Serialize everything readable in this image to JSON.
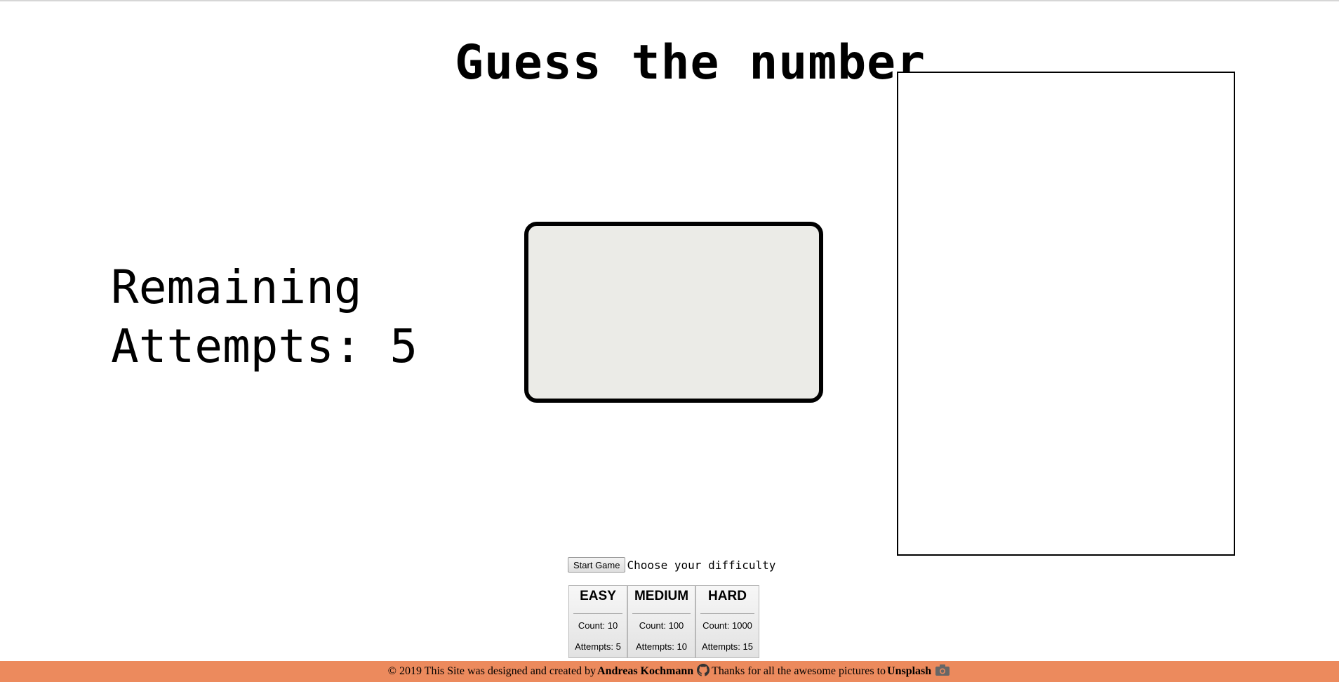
{
  "game": {
    "title": "Guess the number",
    "attempts_label": "Remaining",
    "attempts_line2": "Attempts: 5",
    "remaining_attempts": 5,
    "current_number": ""
  },
  "controls": {
    "start_label": "Start Game",
    "difficulty_prompt": "Choose your difficulty"
  },
  "difficulties": [
    {
      "name": "EASY",
      "count": "Count: 10",
      "attempts": "Attempts: 5"
    },
    {
      "name": "MEDIUM",
      "count": "Count: 100",
      "attempts": "Attempts: 10"
    },
    {
      "name": "HARD",
      "count": "Count: 1000",
      "attempts": "Attempts: 15"
    }
  ],
  "footer": {
    "text_prefix": "© 2019 This Site was designed and created by",
    "author": "Andreas Kochmann",
    "author_icon": "github-icon",
    "thanks_text": "Thanks for all the awesome pictures to",
    "credit": "Unsplash",
    "credit_icon": "camera-icon"
  },
  "colors": {
    "footer_bg": "#ec8a5d",
    "display_bg": "#ebebe7"
  }
}
